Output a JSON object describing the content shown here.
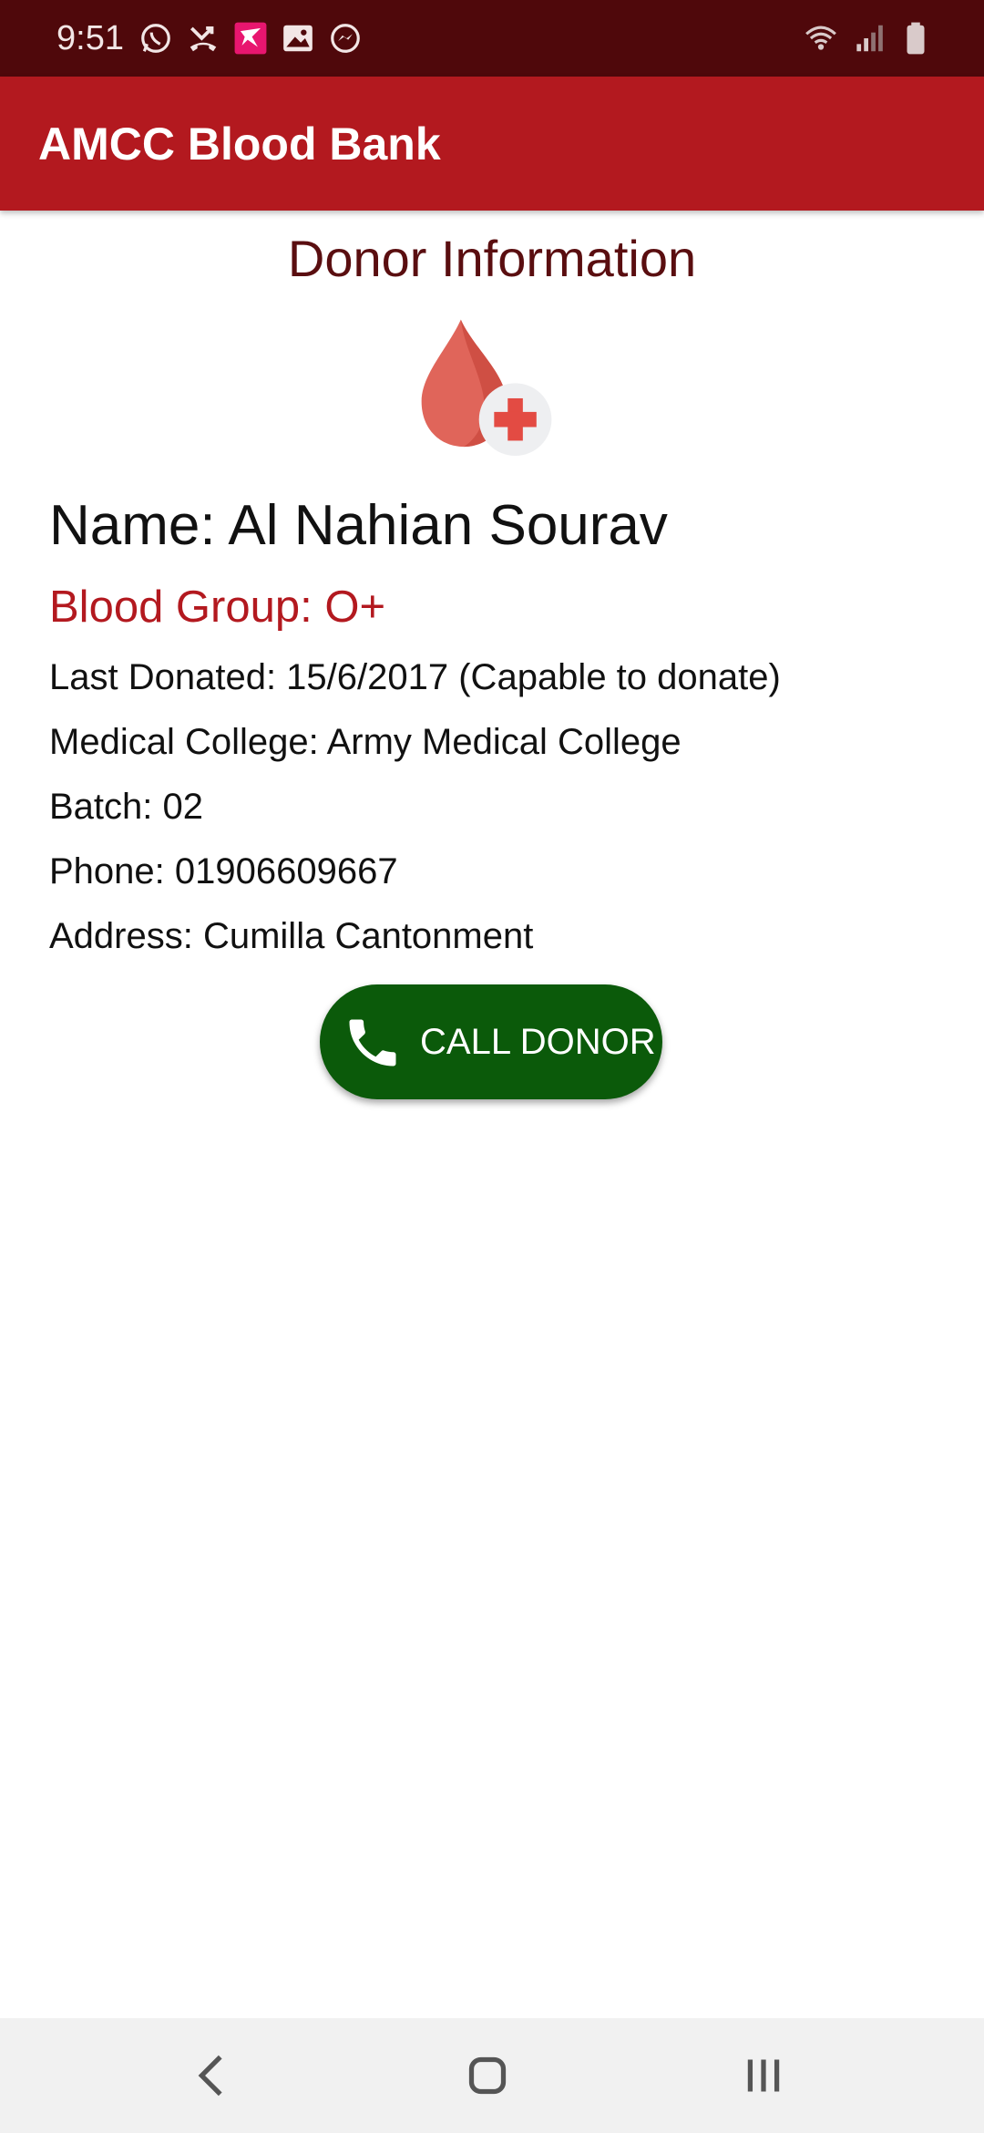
{
  "status_bar": {
    "time": "9:51",
    "left_icons": [
      "whatsapp-icon",
      "missed-call-icon",
      "app-notification-icon",
      "gallery-icon",
      "messenger-icon"
    ],
    "right_icons": [
      "wifi-icon",
      "signal-icon",
      "battery-icon"
    ],
    "background_color": "#4f080b"
  },
  "app_bar": {
    "title": "AMCC Blood Bank",
    "background_color": "#b3191f"
  },
  "donor": {
    "heading": "Donor Information",
    "icon": "blood-drop-plus-icon",
    "name": "Name: Al Nahian Sourav",
    "blood_group": "Blood Group: O+",
    "last_donated": "Last Donated: 15/6/2017 (Capable to donate)",
    "medical_college": "Medical College: Army Medical College",
    "batch": "Batch: 02",
    "phone": "Phone: 01906609667",
    "address": "Address: Cumilla Cantonment"
  },
  "call_button": {
    "label": "CALL DONOR",
    "icon": "phone-icon",
    "background_color": "#0b5a0a"
  },
  "nav_bar": {
    "buttons": [
      "back-icon",
      "home-icon",
      "recents-icon"
    ]
  }
}
